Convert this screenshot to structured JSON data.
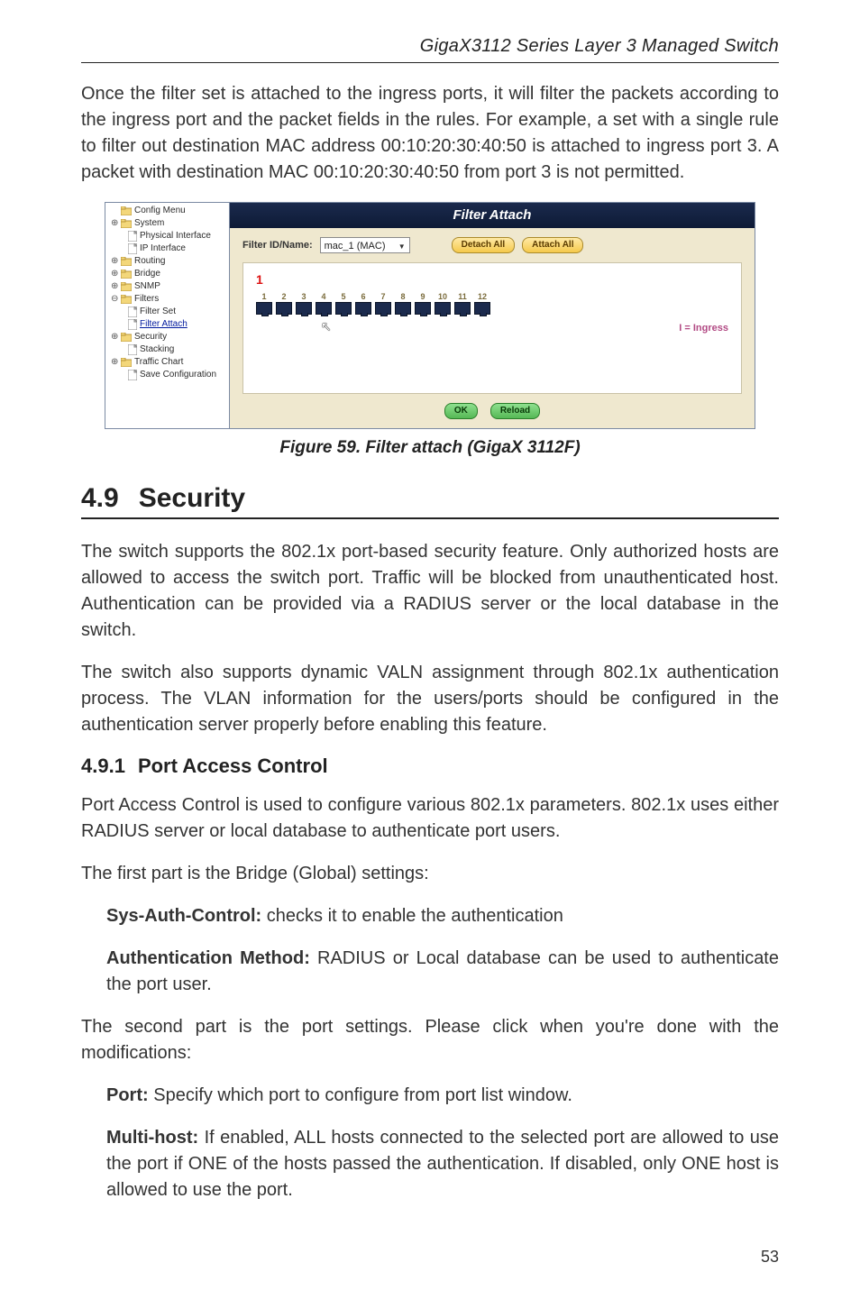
{
  "running_head": "GigaX3112 Series Layer 3 Managed Switch",
  "intro_para": "Once the filter set is attached to the ingress ports, it will filter the packets according to the ingress port and the packet fields in the rules. For example, a set with a single rule to filter out destination MAC address 00:10:20:30:40:50 is attached to ingress port 3. A packet with destination MAC 00:10:20:30:40:50 from port 3 is not permitted.",
  "figure_caption": "Figure 59. Filter attach (GigaX 3112F)",
  "section": {
    "num": "4.9",
    "title": "Security"
  },
  "sec_para1": "The switch supports the 802.1x port-based security feature. Only authorized hosts are allowed to access the switch port. Traffic will be blocked from unauthenticated host. Authentication can be provided via a RADIUS server or the local database in the switch.",
  "sec_para2": "The switch also supports dynamic VALN assignment through 802.1x authentication process. The VLAN information for the users/ports should be configured in the authentication server properly before enabling this feature.",
  "subsection": {
    "num": "4.9.1",
    "title": "Port Access Control"
  },
  "sub_para1": "Port Access Control is used to configure various 802.1x parameters. 802.1x uses either RADIUS server or local database to authenticate port users.",
  "sub_para2": "The first part is the Bridge (Global) settings:",
  "def1": {
    "term": "Sys-Auth-Control:",
    "body": " checks it to enable the authentication"
  },
  "def2": {
    "term": "Authentication Method:",
    "body": " RADIUS or Local database can be used to authenticate the port user."
  },
  "sub_para3": "The second part is the port settings. Please click  when you're done with the modifications:",
  "def3": {
    "term": "Port:",
    "body": " Specify which port to configure from port list window."
  },
  "def4": {
    "term": "Multi-host:",
    "body": " If enabled, ALL hosts connected to the selected port are allowed to use the port if ONE of the hosts passed the authentication. If disabled, only ONE host is allowed to use the port."
  },
  "page_number": "53",
  "ui": {
    "titlebar": "Filter Attach",
    "filter_label": "Filter ID/Name:",
    "filter_value": "mac_1 (MAC)",
    "btn_detach": "Detach All",
    "btn_attach": "Attach All",
    "unit_index": "1",
    "ports": [
      "1",
      "2",
      "3",
      "4",
      "5",
      "6",
      "7",
      "8",
      "9",
      "10",
      "11",
      "12"
    ],
    "legend": "I = Ingress",
    "btn_ok": "OK",
    "btn_reload": "Reload",
    "tree": [
      {
        "label": "Config Menu",
        "type": "folder",
        "level": 0,
        "toggle": ""
      },
      {
        "label": "System",
        "type": "folder",
        "level": 0,
        "toggle": "⊕"
      },
      {
        "label": "Physical Interface",
        "type": "page",
        "level": 1,
        "toggle": ""
      },
      {
        "label": "IP Interface",
        "type": "page",
        "level": 1,
        "toggle": ""
      },
      {
        "label": "Routing",
        "type": "folder",
        "level": 0,
        "toggle": "⊕"
      },
      {
        "label": "Bridge",
        "type": "folder",
        "level": 0,
        "toggle": "⊕"
      },
      {
        "label": "SNMP",
        "type": "folder",
        "level": 0,
        "toggle": "⊕"
      },
      {
        "label": "Filters",
        "type": "folder",
        "level": 0,
        "toggle": "⊖"
      },
      {
        "label": "Filter Set",
        "type": "page",
        "level": 1,
        "toggle": ""
      },
      {
        "label": "Filter Attach",
        "type": "page",
        "level": 1,
        "toggle": "",
        "selected": true
      },
      {
        "label": "Security",
        "type": "folder",
        "level": 0,
        "toggle": "⊕"
      },
      {
        "label": "Stacking",
        "type": "page",
        "level": 1,
        "toggle": ""
      },
      {
        "label": "Traffic Chart",
        "type": "folder",
        "level": 0,
        "toggle": "⊕"
      },
      {
        "label": "Save Configuration",
        "type": "page",
        "level": 1,
        "toggle": ""
      }
    ]
  }
}
